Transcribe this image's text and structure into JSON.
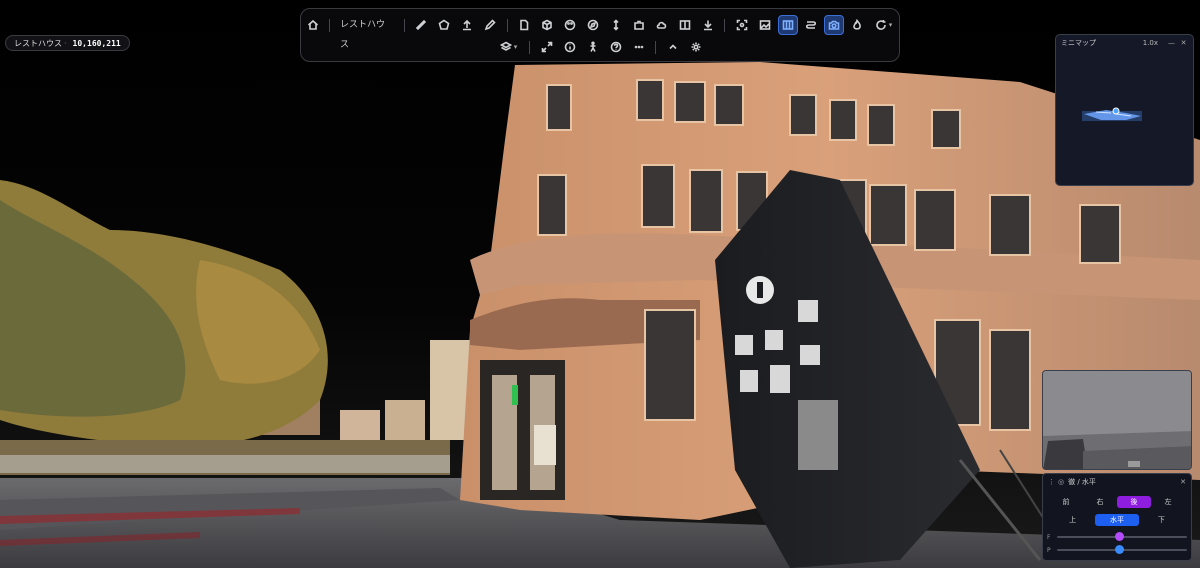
{
  "app": {
    "point_count_label": "レストハウス",
    "point_count_value": "10,160,211"
  },
  "toolbar": {
    "home_icon": "home-icon",
    "project_label": "レストハウス",
    "row1_icons": [
      "ruler-icon",
      "polygon-icon",
      "upload-icon",
      "pen-icon",
      "document-icon",
      "cube-icon",
      "palette-icon",
      "compass-icon",
      "height-icon",
      "puzzle-icon",
      "cloud-icon",
      "split-view-icon",
      "download-icon",
      "focus-icon",
      "image-edit-icon",
      "panel-view-icon",
      "route-icon",
      "camera-icon",
      "flame-icon",
      "refresh-icon"
    ],
    "row2_icons": [
      "layers-icon",
      "expand-icon",
      "info-icon",
      "walk-icon",
      "help-icon",
      "more-icon",
      "collapse-icon",
      "settings-icon"
    ],
    "active_icons": [
      "panel-view-icon",
      "camera-icon"
    ]
  },
  "minimap": {
    "title": "ミニマップ",
    "zoom": "1.0x",
    "minimize_icon": "minimize-icon",
    "close_icon": "close-icon"
  },
  "view_panel": {
    "title": "徹 / 水平",
    "close": "✕",
    "row1": [
      "前",
      "右",
      "後",
      "左"
    ],
    "row1_selected": 2,
    "row2": [
      "上",
      "水平",
      "下"
    ],
    "row2_selected": 1,
    "slider1_label": "F",
    "slider1_value": 0.48,
    "slider2_label": "P",
    "slider2_value": 0.48
  },
  "colors": {
    "accent_blue": "#1d5ff0",
    "accent_purple": "#8f1de0",
    "panel_bg": "#121420"
  }
}
